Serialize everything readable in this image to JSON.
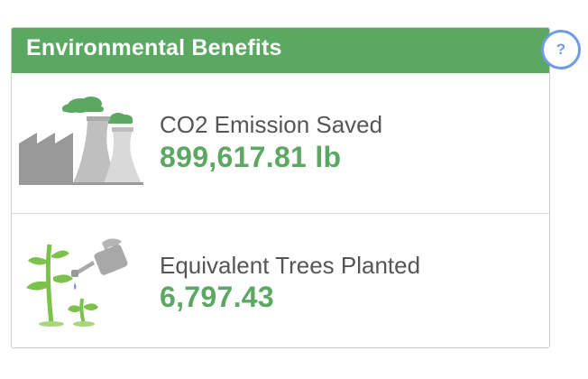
{
  "panel": {
    "title": "Environmental Benefits",
    "help_label": "?"
  },
  "metrics": [
    {
      "label": "CO2 Emission Saved",
      "value": "899,617.81 lb",
      "icon": "factory-icon"
    },
    {
      "label": "Equivalent Trees Planted",
      "value": "6,797.43",
      "icon": "tree-watering-icon"
    }
  ],
  "colors": {
    "accent_green": "#5aa861",
    "help_blue": "#6d9be8",
    "label_text": "#555555",
    "border": "#cfcfcf"
  }
}
